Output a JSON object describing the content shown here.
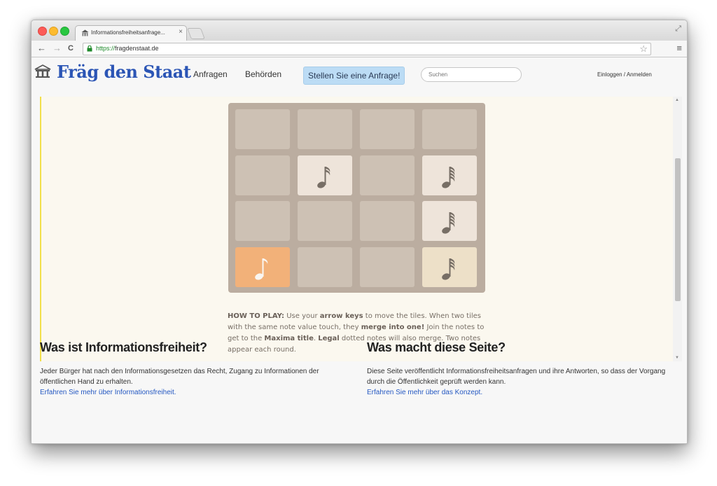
{
  "browser": {
    "tab_title": "Informationsfreiheitsanfrage...",
    "tab_close": "×",
    "url_protocol": "https://",
    "url_host": "fragdenstaat.de",
    "back_icon": "←",
    "forward_icon": "→",
    "reload_icon": "C",
    "star_icon": "☆",
    "menu_icon": "≡",
    "expand_icon": "⤢"
  },
  "site": {
    "logo_text": "Fräg den Staat",
    "nav": [
      "Anfragen",
      "Behörden"
    ],
    "cta_label": "Stellen Sie eine Anfrage!",
    "search_placeholder": "Suchen",
    "login_label": "Einloggen / Anmelden"
  },
  "game": {
    "grid": [
      [
        "",
        "",
        "",
        ""
      ],
      [
        "",
        "sixteenth",
        "",
        "sixtyfourth"
      ],
      [
        "",
        "",
        "",
        "sixtyfourth"
      ],
      [
        "eighth",
        "",
        "",
        "thirtysecond"
      ]
    ],
    "howto": {
      "lead": "HOW TO PLAY:",
      "t1": " Use your ",
      "b1": "arrow keys",
      "t2": " to move the tiles. When two tiles with the same note value touch, they ",
      "b2": "merge into one!",
      "t3": " Join the notes to get to the ",
      "b3": "Maxima title",
      "t4": ". ",
      "b4": "Legal",
      "t5": " dotted notes will also merge. Two notes appear each round."
    }
  },
  "info": {
    "left": {
      "title": "Was ist Informationsfreiheit?",
      "body": "Jeder Bürger hat nach den Informationsgesetzen das Recht, Zugang zu Informationen der öffentlichen Hand zu erhalten.",
      "link": "Erfahren Sie mehr über Informationsfreiheit."
    },
    "right": {
      "title": "Was macht diese Seite?",
      "body": "Diese Seite veröffentlicht Informationsfreiheitsanfragen und ihre Antworten, so dass der Vorgang durch die Öffentlichkeit geprüft werden kann.",
      "link": "Erfahren Sie mehr über das Konzept."
    }
  },
  "colors": {
    "board": "#bbada0",
    "empty_tile": "#cdc1b4",
    "note_tile": "#eee4da",
    "orange_tile": "#f2b179",
    "cream_tile": "#ede0c8",
    "link": "#2458c2",
    "logo": "#2b55b5",
    "cta": "#bcdcf5"
  }
}
